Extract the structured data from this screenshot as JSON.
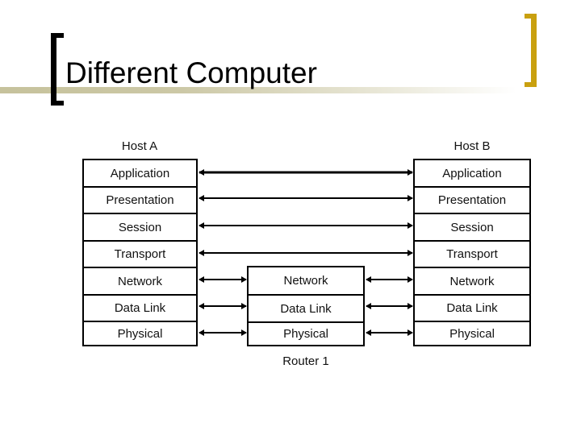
{
  "slide": {
    "title": "Different Computer",
    "accent_colors": {
      "left_bracket": "#000000",
      "right_bracket": "#c9a00f",
      "underline": "#c6c29c"
    }
  },
  "diagram": {
    "host_a": {
      "label": "Host A",
      "layers": [
        "Application",
        "Presentation",
        "Session",
        "Transport",
        "Network",
        "Data Link",
        "Physical"
      ]
    },
    "router": {
      "label": "Router 1",
      "layers": [
        "Network",
        "Data Link",
        "Physical"
      ]
    },
    "host_b": {
      "label": "Host B",
      "layers": [
        "Application",
        "Presentation",
        "Session",
        "Transport",
        "Network",
        "Data Link",
        "Physical"
      ]
    },
    "peer_links": [
      {
        "from": "Host A",
        "to": "Host B",
        "layer": "Application"
      },
      {
        "from": "Host A",
        "to": "Host B",
        "layer": "Presentation"
      },
      {
        "from": "Host A",
        "to": "Host B",
        "layer": "Session"
      },
      {
        "from": "Host A",
        "to": "Host B",
        "layer": "Transport"
      },
      {
        "from": "Host A",
        "to": "Router 1",
        "layer": "Network"
      },
      {
        "from": "Host A",
        "to": "Router 1",
        "layer": "Data Link"
      },
      {
        "from": "Host A",
        "to": "Router 1",
        "layer": "Physical"
      },
      {
        "from": "Router 1",
        "to": "Host B",
        "layer": "Network"
      },
      {
        "from": "Router 1",
        "to": "Host B",
        "layer": "Data Link"
      },
      {
        "from": "Router 1",
        "to": "Host B",
        "layer": "Physical"
      }
    ]
  }
}
